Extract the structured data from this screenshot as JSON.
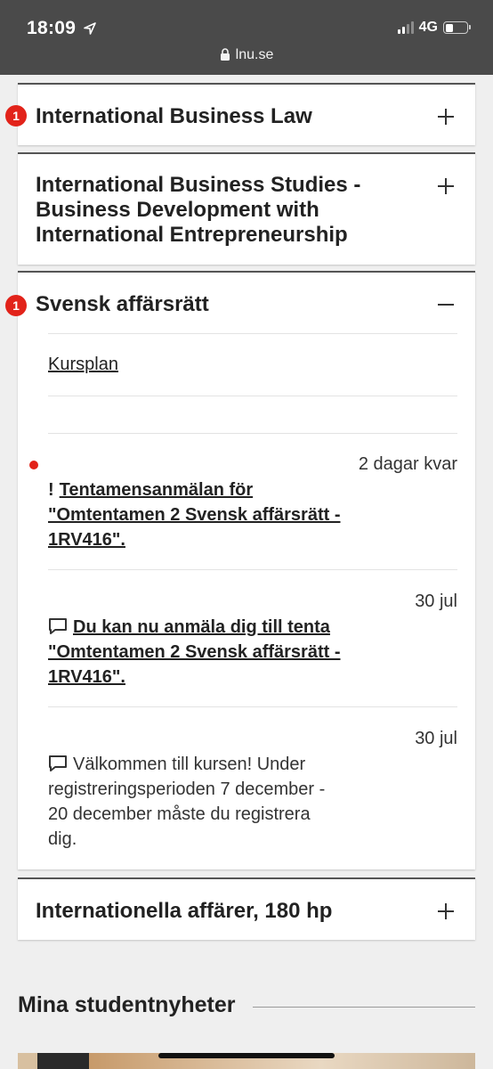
{
  "status_bar": {
    "time": "18:09",
    "network": "4G",
    "url": "lnu.se",
    "background_color": "#4a4a4a"
  },
  "courses": [
    {
      "title": "International Business Law",
      "badge": "1",
      "toggle": "plus"
    },
    {
      "title_lines": [
        "International Business Studies -",
        "Business Development with",
        "International Entrepreneurship"
      ],
      "toggle": "plus"
    },
    {
      "title": "Svensk affärsrätt",
      "badge": "1",
      "toggle": "minus",
      "kursplan_label": "Kursplan",
      "notices": [
        {
          "date": "2 dagar kvar",
          "icon": "exclamation-icon",
          "lines": [
            "Tentamensanmälan för",
            "\"Omtentamen 2 Svensk affärsrätt -",
            "1RV416\"."
          ],
          "unread": true
        },
        {
          "date": "30 jul",
          "icon": "speech-bubble-icon",
          "lines": [
            "Du kan nu anmäla dig till tenta",
            "\"Omtentamen 2 Svensk affärsrätt -",
            "1RV416\"."
          ]
        },
        {
          "date": "30 jul",
          "icon": "speech-bubble-icon",
          "lines": [
            "Välkommen till kursen! Under",
            "registreringsperioden 7 december -",
            "20 december måste du registrera",
            "dig."
          ]
        }
      ]
    },
    {
      "title": "Internationella affärer, 180 hp",
      "toggle": "plus"
    }
  ],
  "news_section": {
    "title": "Mina studentnyheter"
  },
  "colors": {
    "accent_red": "#e2231a",
    "card_border": "#555555",
    "page_bg": "#efefef"
  }
}
